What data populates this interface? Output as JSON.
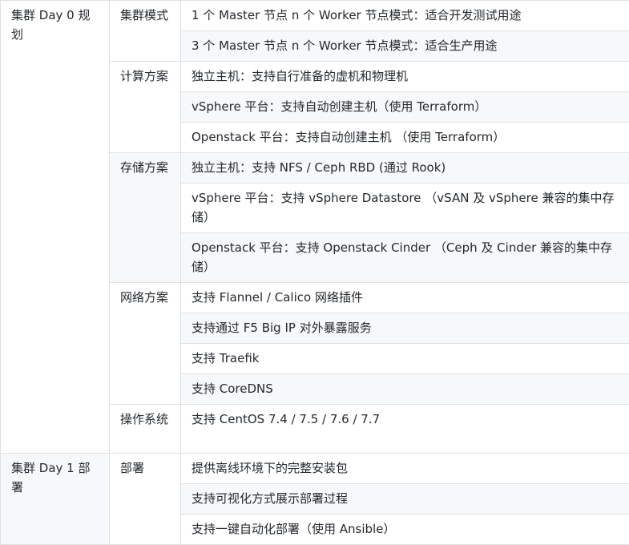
{
  "table": {
    "stages": [
      {
        "title": "集群 Day 0 规划",
        "categories": [
          {
            "name": "集群模式",
            "items": [
              "1 个 Master 节点 n 个 Worker 节点模式：适合开发测试用途",
              "3 个 Master 节点 n 个 Worker 节点模式：适合生产用途"
            ]
          },
          {
            "name": "计算方案",
            "items": [
              "独立主机：支持自行准备的虚机和物理机",
              "vSphere 平台：支持自动创建主机（使用 Terraform）",
              "Openstack 平台：支持自动创建主机 （使用 Terraform）"
            ]
          },
          {
            "name": "存储方案",
            "items": [
              "独立主机：支持 NFS / Ceph RBD (通过 Rook)",
              "vSphere 平台：支持 vSphere Datastore （vSAN 及 vSphere 兼容的集中存储）",
              "Openstack 平台：支持 Openstack Cinder （Ceph 及 Cinder 兼容的集中存储）"
            ]
          },
          {
            "name": "网络方案",
            "items": [
              "支持 Flannel / Calico 网络插件",
              "支持通过 F5 Big IP 对外暴露服务",
              "支持 Traefik",
              "支持 CoreDNS"
            ]
          },
          {
            "name": "操作系统",
            "items": [
              "支持 CentOS 7.4 / 7.5 / 7.6 / 7.7"
            ]
          }
        ]
      },
      {
        "title": "集群 Day 1 部署",
        "categories": [
          {
            "name": "部署",
            "items": [
              "提供离线环境下的完整安装包",
              "支持可视化方式展示部署过程",
              "支持一键自动化部署（使用 Ansible）"
            ]
          }
        ]
      }
    ]
  }
}
